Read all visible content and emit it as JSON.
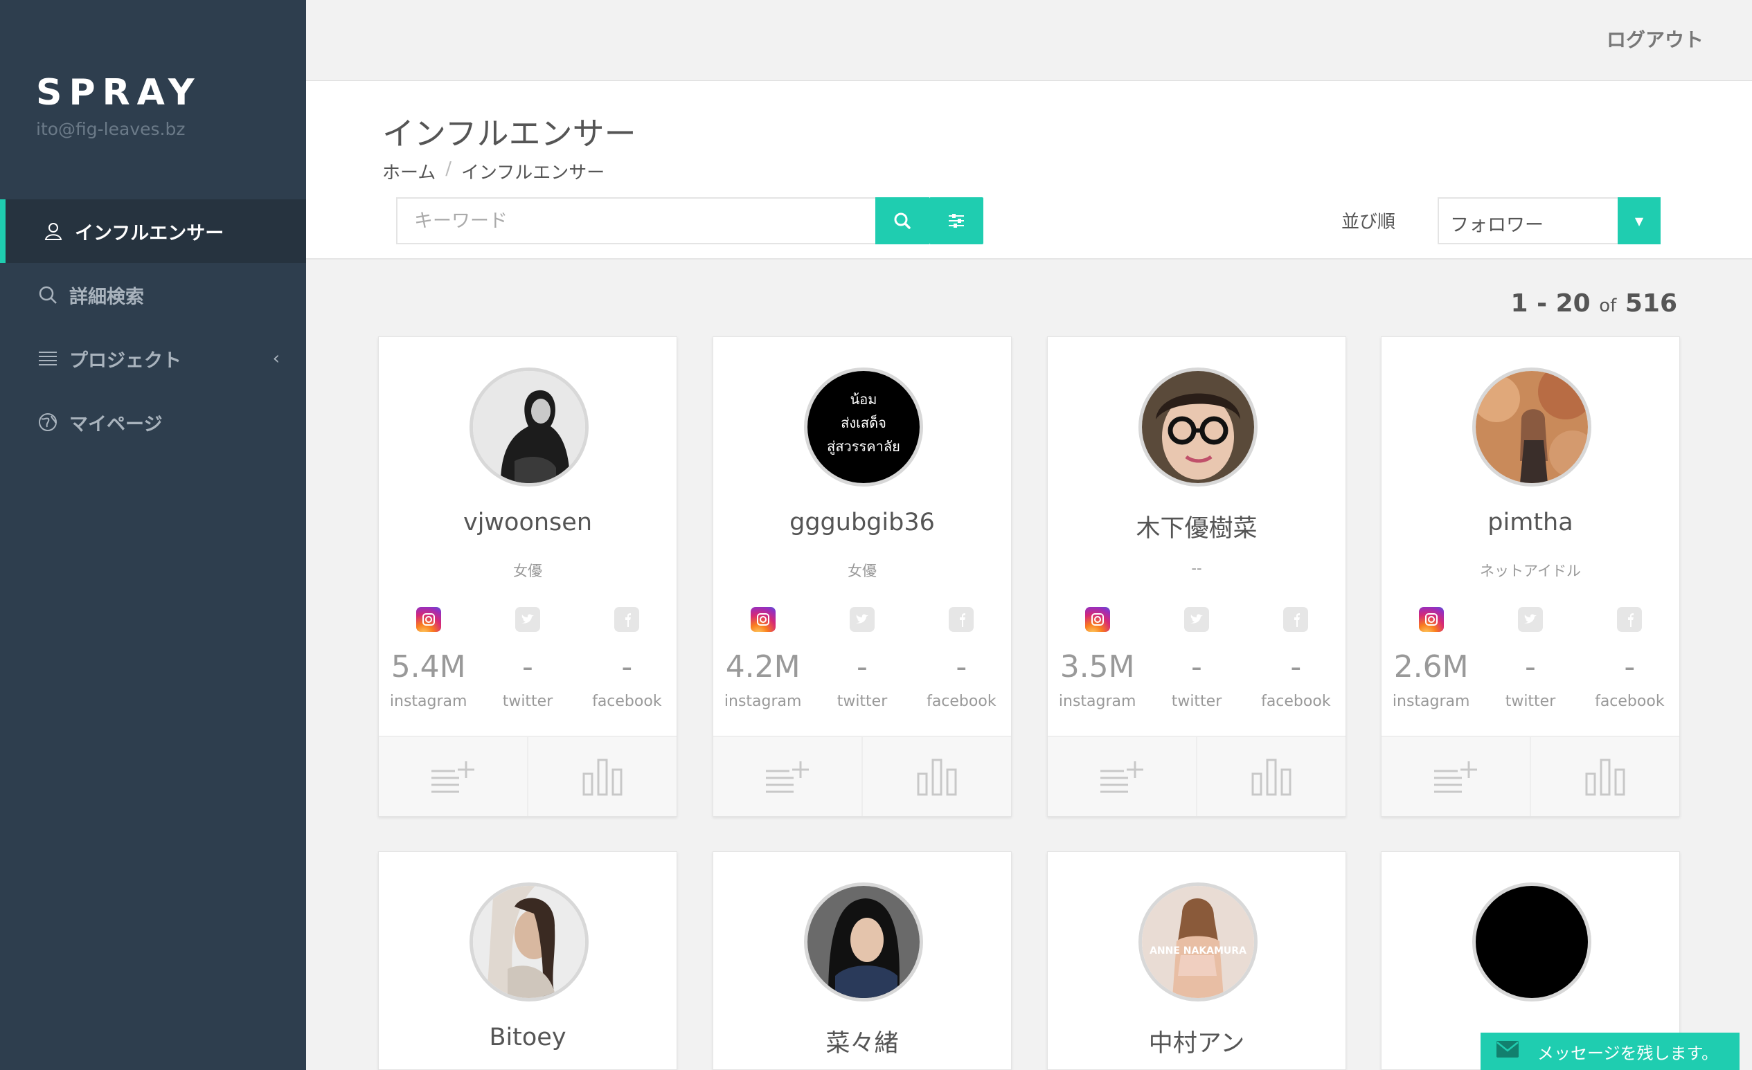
{
  "app": {
    "brand": "SPRAY",
    "email": "ito@fig-leaves.bz",
    "accent": "#1fcdb0",
    "sidebar_bg": "#2e3e4e"
  },
  "sidebar": {
    "items": [
      {
        "label": "インフルエンサー",
        "icon": "user-icon",
        "active": true
      },
      {
        "label": "詳細検索",
        "icon": "search-icon",
        "active": false
      },
      {
        "label": "プロジェクト",
        "icon": "list-icon",
        "active": false,
        "chevron": "‹"
      },
      {
        "label": "マイページ",
        "icon": "globe-icon",
        "active": false
      }
    ]
  },
  "topbar": {
    "logout": "ログアウト"
  },
  "header": {
    "title": "インフルエンサー",
    "breadcrumb": [
      "ホーム",
      "インフルエンサー"
    ],
    "breadcrumb_sep": "/",
    "search_placeholder": "キーワード",
    "sort_label": "並び順",
    "sort_value": "フォロワー"
  },
  "results": {
    "range": "1 - 20",
    "of": "of",
    "total": "516"
  },
  "cards": [
    {
      "name": "vjwoonsen",
      "category": "女優",
      "instagram": "5.4M",
      "twitter": "-",
      "facebook": "-"
    },
    {
      "name": "gggubgib36",
      "category": "女優",
      "instagram": "4.2M",
      "twitter": "-",
      "facebook": "-",
      "avatar_text": [
        "น้อม",
        "ส่งเสด็จ",
        "สู่สวรรคาลัย"
      ]
    },
    {
      "name": "木下優樹菜",
      "category": "--",
      "instagram": "3.5M",
      "twitter": "-",
      "facebook": "-"
    },
    {
      "name": "pimtha",
      "category": "ネットアイドル",
      "instagram": "2.6M",
      "twitter": "-",
      "facebook": "-"
    },
    {
      "name": "Bitoey"
    },
    {
      "name": "菜々緒"
    },
    {
      "name": "中村アン",
      "avatar_text": [
        "ANNE NAKAMURA"
      ]
    },
    {
      "name": ""
    }
  ],
  "stat_labels": {
    "instagram": "instagram",
    "twitter": "twitter",
    "facebook": "facebook"
  },
  "message": {
    "label": "メッセージを残します。"
  }
}
